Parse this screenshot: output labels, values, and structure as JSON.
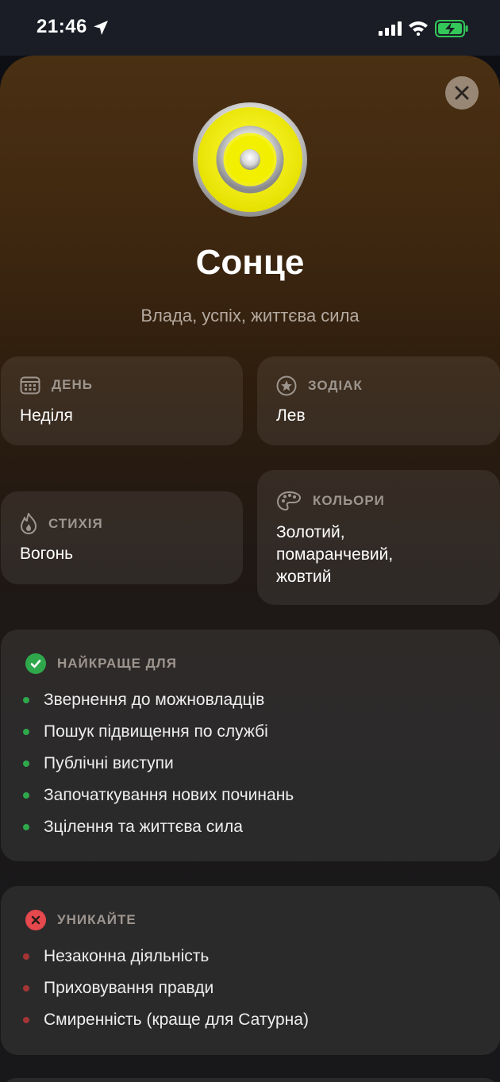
{
  "status": {
    "time": "21:46"
  },
  "planet": {
    "name": "Сонце",
    "tagline": "Влада, успіх, життєва сила"
  },
  "info": {
    "day": {
      "label": "ДЕНЬ",
      "value": "Неділя"
    },
    "zodiac": {
      "label": "ЗОДІАК",
      "value": "Лев"
    },
    "element": {
      "label": "СТИХІЯ",
      "value": "Вогонь"
    },
    "colors": {
      "label": "КОЛЬОРИ",
      "lines": [
        "Золотий,",
        "помаранчевий,",
        "жовтий"
      ]
    }
  },
  "best_for": {
    "label": "НАЙКРАЩЕ ДЛЯ",
    "items": [
      "Звернення до можновладців",
      "Пошук підвищення по службі",
      "Публічні виступи",
      "Започаткування нових починань",
      "Зцілення та життєва сила"
    ]
  },
  "avoid": {
    "label": "УНИКАЙТЕ",
    "items": [
      "Незаконна діяльність",
      "Приховування правди",
      "Смиренність (краще для Сатурна)"
    ]
  },
  "colors_ui": {
    "accent_green": "#2fa84c",
    "accent_red": "#e5484d",
    "sun_yellow": "#f2ef00"
  },
  "icons": [
    "location-arrow-icon",
    "cellular-signal-icon",
    "wifi-icon",
    "battery-charging-icon",
    "close-icon",
    "sun-symbol-icon",
    "calendar-icon",
    "star-circle-icon",
    "fire-icon",
    "palette-icon",
    "check-circle-icon",
    "x-circle-icon"
  ]
}
